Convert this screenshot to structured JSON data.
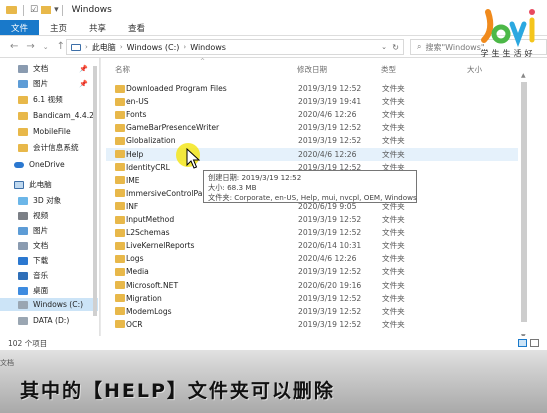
{
  "window": {
    "title": "Windows",
    "qa_chevron": "▾"
  },
  "ribbon": {
    "tabs": [
      {
        "label": "文件",
        "active": true
      },
      {
        "label": "主页",
        "active": false
      },
      {
        "label": "共享",
        "active": false
      },
      {
        "label": "查看",
        "active": false
      }
    ]
  },
  "address": {
    "crumbs": [
      "此电脑",
      "Windows (C:)",
      "Windows"
    ],
    "search_placeholder": "搜索\"Windows\""
  },
  "sidebar": {
    "items": [
      {
        "label": "文档",
        "icon": "documents-icon",
        "pinned": true
      },
      {
        "label": "图片",
        "icon": "pictures-icon",
        "pinned": true
      },
      {
        "label": "6.1 视频",
        "icon": "folder-icon",
        "pinned": false
      },
      {
        "label": "Bandicam_4.4.2",
        "icon": "folder-icon",
        "pinned": false
      },
      {
        "label": "MobileFile",
        "icon": "folder-icon",
        "pinned": false
      },
      {
        "label": "会计信息系统",
        "icon": "folder-icon",
        "pinned": false
      },
      {
        "label": "OneDrive",
        "icon": "onedrive-icon",
        "pinned": false
      },
      {
        "label": "此电脑",
        "icon": "this-pc-icon",
        "pinned": false
      },
      {
        "label": "3D 对象",
        "icon": "3d-objects-icon",
        "pinned": false
      },
      {
        "label": "视频",
        "icon": "videos-icon",
        "pinned": false
      },
      {
        "label": "图片",
        "icon": "pictures-icon",
        "pinned": false
      },
      {
        "label": "文档",
        "icon": "documents-icon",
        "pinned": false
      },
      {
        "label": "下载",
        "icon": "downloads-icon",
        "pinned": false
      },
      {
        "label": "音乐",
        "icon": "music-icon",
        "pinned": false
      },
      {
        "label": "桌面",
        "icon": "desktop-icon",
        "pinned": false
      },
      {
        "label": "Windows (C:)",
        "icon": "drive-icon",
        "pinned": false,
        "selected": true
      },
      {
        "label": "DATA (D:)",
        "icon": "drive-icon",
        "pinned": false
      }
    ]
  },
  "columns": {
    "name": "名称",
    "date": "修改日期",
    "type": "类型",
    "size": "大小"
  },
  "files": [
    {
      "name": "Downloaded Program Files",
      "date": "2019/3/19 12:52",
      "type": "文件夹"
    },
    {
      "name": "en-US",
      "date": "2019/3/19 19:41",
      "type": "文件夹"
    },
    {
      "name": "Fonts",
      "date": "2020/4/6 12:26",
      "type": "文件夹"
    },
    {
      "name": "GameBarPresenceWriter",
      "date": "2019/3/19 12:52",
      "type": "文件夹"
    },
    {
      "name": "Globalization",
      "date": "2019/3/19 12:52",
      "type": "文件夹"
    },
    {
      "name": "Help",
      "date": "2020/4/6 12:26",
      "type": "文件夹",
      "highlighted": true
    },
    {
      "name": "IdentityCRL",
      "date": "2019/3/19 12:52",
      "type": "文件夹"
    },
    {
      "name": "IME",
      "date": "2019/3/19 12:52",
      "type": "文件夹"
    },
    {
      "name": "ImmersiveControlPan",
      "date": "2019/3/19 12:52",
      "type": "文件夹"
    },
    {
      "name": "INF",
      "date": "2020/6/19 9:05",
      "type": "文件夹"
    },
    {
      "name": "InputMethod",
      "date": "2019/3/19 12:52",
      "type": "文件夹"
    },
    {
      "name": "L2Schemas",
      "date": "2019/3/19 12:52",
      "type": "文件夹"
    },
    {
      "name": "LiveKernelReports",
      "date": "2020/6/14 10:31",
      "type": "文件夹"
    },
    {
      "name": "Logs",
      "date": "2020/4/6 12:26",
      "type": "文件夹"
    },
    {
      "name": "Media",
      "date": "2019/3/19 12:52",
      "type": "文件夹"
    },
    {
      "name": "Microsoft.NET",
      "date": "2020/6/20 19:16",
      "type": "文件夹"
    },
    {
      "name": "Migration",
      "date": "2019/3/19 12:52",
      "type": "文件夹"
    },
    {
      "name": "ModemLogs",
      "date": "2019/3/19 12:52",
      "type": "文件夹"
    },
    {
      "name": "OCR",
      "date": "2019/3/19 12:52",
      "type": "文件夹"
    }
  ],
  "tooltip": {
    "line1": "创建日期: 2019/3/19 12:52",
    "line2": "大小: 68.3 MB",
    "line3": "文件夹: Corporate, en-US, Help, mui, nvcpl, OEM, Windows"
  },
  "status": {
    "count": "102 个项目"
  },
  "caption": {
    "text": "其中的【HELP】文件夹可以删除",
    "left_label": "文档"
  },
  "logo": {
    "tagline": "学生生活好"
  },
  "colors": {
    "accent": "#1979ca",
    "folder": "#e8b84a",
    "selection": "#cce4f7",
    "highlight": "#e5f1fb",
    "cursor_glow": "#f5e61b"
  }
}
